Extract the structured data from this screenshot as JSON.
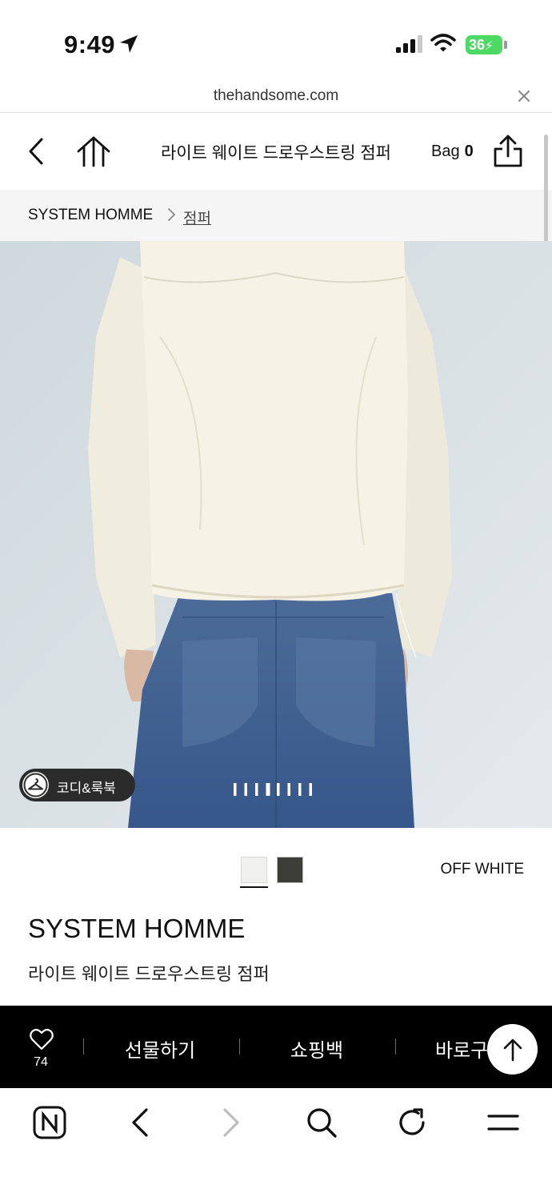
{
  "status_bar": {
    "time": "9:49",
    "battery": "36",
    "battery_color": "#4cd964"
  },
  "url_bar": {
    "url": "thehandsome.com"
  },
  "header": {
    "title": "라이트 웨이트 드로우스트링 점퍼",
    "bag_label": "Bag",
    "bag_count": "0"
  },
  "breadcrumb": {
    "brand": "SYSTEM HOMME",
    "category": "점퍼"
  },
  "gallery": {
    "coordi_label": "코디&룩북",
    "slide_count": 8,
    "active_slide": 3
  },
  "colors": {
    "selected_name": "OFF WHITE",
    "swatches": [
      {
        "name": "off-white",
        "hex": "#f0f0ee",
        "selected": true
      },
      {
        "name": "dark",
        "hex": "#3d3d38",
        "selected": false
      }
    ]
  },
  "product": {
    "brand": "SYSTEM HOMME",
    "name": "라이트 웨이트 드로우스트링 점퍼"
  },
  "action_bar": {
    "like_count": "74",
    "gift_label": "선물하기",
    "bag_label": "쇼핑백",
    "buy_label": "바로구매"
  },
  "icons": [
    "location-arrow-icon",
    "signal-icon",
    "wifi-icon",
    "close-icon",
    "back-icon",
    "home-icon",
    "share-icon",
    "chevron-right-icon",
    "hanger-icon",
    "heart-icon",
    "arrow-up-icon",
    "naver-icon",
    "browser-back-icon",
    "browser-forward-icon",
    "search-icon",
    "refresh-icon",
    "menu-icon"
  ]
}
